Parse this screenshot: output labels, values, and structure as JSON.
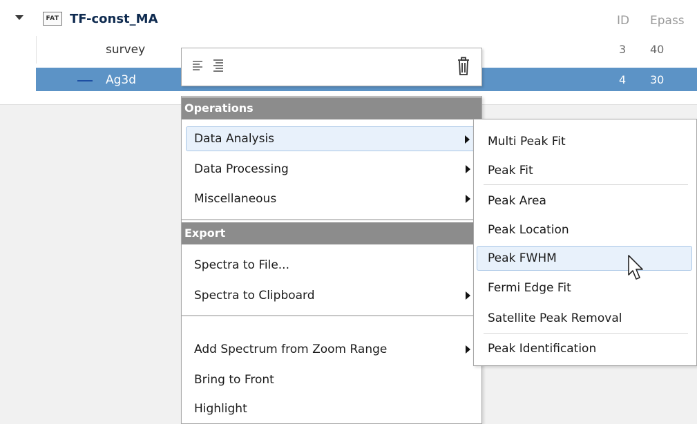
{
  "tree": {
    "group": {
      "badge": "FAT",
      "name": "TF-const_MA"
    },
    "columns": {
      "id": "ID",
      "epass": "Epass"
    },
    "rows": [
      {
        "name": "survey",
        "id": "3",
        "epass": "40",
        "selected": false
      },
      {
        "name": "Ag3d",
        "id": "4",
        "epass": "30",
        "selected": true
      }
    ]
  },
  "toolbar": {
    "icons": [
      "align-left-icon",
      "align-right-icon",
      "trash-icon"
    ]
  },
  "menu": {
    "operations_header": "Operations",
    "operations_items": [
      {
        "label": "Data Analysis",
        "has_submenu": true,
        "highlighted": true
      },
      {
        "label": "Data Processing",
        "has_submenu": true,
        "highlighted": false
      },
      {
        "label": "Miscellaneous",
        "has_submenu": true,
        "highlighted": false
      }
    ],
    "export_header": "Export",
    "export_items": [
      {
        "label": "Spectra to File...",
        "has_submenu": false
      },
      {
        "label": "Spectra to Clipboard",
        "has_submenu": true
      }
    ],
    "other_items": [
      {
        "label": "Add Spectrum from Zoom Range",
        "has_submenu": true
      },
      {
        "label": "Bring to Front",
        "has_submenu": false
      },
      {
        "label": "Highlight",
        "has_submenu": false
      }
    ]
  },
  "submenu": {
    "items": [
      {
        "label": "Multi Peak Fit",
        "highlighted": false
      },
      {
        "label": "Peak Fit",
        "highlighted": false
      },
      {
        "label": "Peak Area",
        "highlighted": false
      },
      {
        "label": "Peak Location",
        "highlighted": false
      },
      {
        "label": "Peak FWHM",
        "highlighted": true
      },
      {
        "label": "Fermi Edge Fit",
        "highlighted": false
      },
      {
        "label": "Satellite Peak Removal",
        "highlighted": false
      },
      {
        "label": "Peak Identification",
        "highlighted": false
      }
    ]
  },
  "colors": {
    "selection": "#5c93c6",
    "header_bar": "#8c8c8c",
    "hover_bg": "#e8f1fb",
    "hover_border": "#a9c6e6"
  }
}
